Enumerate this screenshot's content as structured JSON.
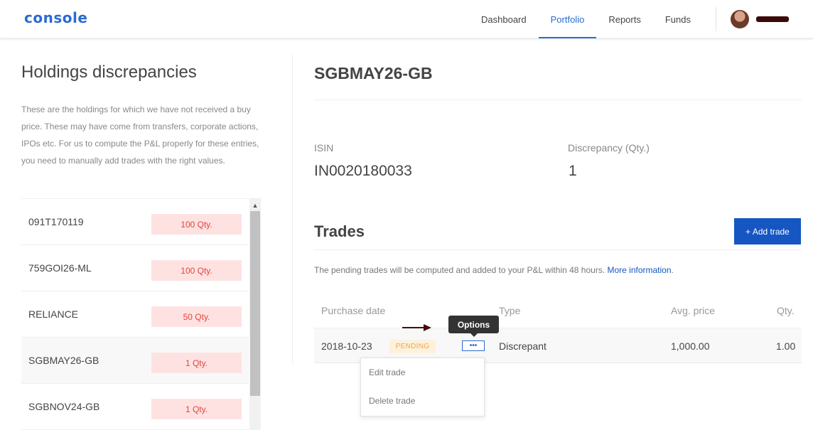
{
  "header": {
    "logo": "console",
    "nav": [
      "Dashboard",
      "Portfolio",
      "Reports",
      "Funds"
    ],
    "active_nav": "Portfolio"
  },
  "left": {
    "title": "Holdings discrepancies",
    "description": "These are the holdings for which we have not received a buy price. These may have come from transfers, corporate actions, IPOs etc. For us to compute the P&L properly for these entries, you need to manually add trades with the right values.",
    "holdings": [
      {
        "name": "091T170119",
        "qty": "100 Qty."
      },
      {
        "name": "759GOI26-ML",
        "qty": "100 Qty."
      },
      {
        "name": "RELIANCE",
        "qty": "50 Qty."
      },
      {
        "name": "SGBMAY26-GB",
        "qty": "1 Qty.",
        "selected": true
      },
      {
        "name": "SGBNOV24-GB",
        "qty": "1 Qty."
      }
    ]
  },
  "detail": {
    "symbol": "SGBMAY26-GB",
    "isin_label": "ISIN",
    "isin_value": "IN0020180033",
    "discrepancy_label": "Discrepancy (Qty.)",
    "discrepancy_value": "1",
    "trades_title": "Trades",
    "add_trade_label": "+ Add trade",
    "pending_note": "The pending trades will be computed and added to your P&L within 48 hours. ",
    "more_info_label": "More information",
    "more_info_suffix": ".",
    "columns": {
      "purchase_date": "Purchase date",
      "type": "Type",
      "avg_price": "Avg. price",
      "qty": "Qty."
    },
    "trade": {
      "date": "2018-10-23",
      "status": "PENDING",
      "options_glyph": "•••",
      "type": "Discrepant",
      "avg_price": "1,000.00",
      "qty": "1.00"
    },
    "tooltip": "Options",
    "menu": [
      "Edit trade",
      "Delete trade"
    ]
  },
  "colors": {
    "brand_blue": "#1556c3",
    "qty_badge_bg": "#fee2e2",
    "qty_badge_text": "#e0453a",
    "pending_bg": "#fdf1dc",
    "pending_text": "#f0a64a"
  }
}
